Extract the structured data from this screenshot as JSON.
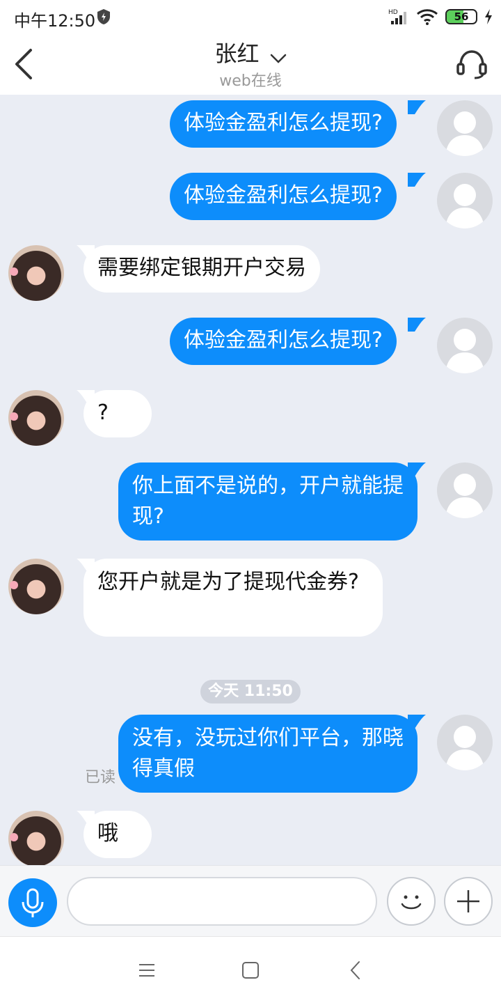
{
  "status_bar": {
    "time": "中午12:50",
    "network_label": "HD",
    "battery_level": "56",
    "battery_fraction": 0.56
  },
  "header": {
    "contact_name": "张红",
    "online_status": "web在线"
  },
  "messages": [
    {
      "sender": "me",
      "text": "体验金盈利怎么提现?"
    },
    {
      "sender": "me",
      "text": "体验金盈利怎么提现?"
    },
    {
      "sender": "them",
      "text": "需要绑定银期开户交易"
    },
    {
      "sender": "me",
      "text": "体验金盈利怎么提现?"
    },
    {
      "sender": "them",
      "text": "?"
    },
    {
      "sender": "me",
      "text": "你上面不是说的，开户就能提现?"
    },
    {
      "sender": "them",
      "text": "您开户就是为了提现代金券?"
    },
    {
      "sender": "me",
      "text": "没有，没玩过你们平台，那晓得真假"
    },
    {
      "sender": "them",
      "text": "哦"
    }
  ],
  "timestamp_divider": "今天 11:50",
  "read_receipt": "已读",
  "input": {
    "value": "",
    "placeholder": ""
  },
  "colors": {
    "accent": "#0d8dfb",
    "chat_background": "#eaedf4",
    "bubble_them": "#ffffff"
  },
  "icons": {
    "mic": "microphone-icon",
    "emoji": "smiley-icon",
    "plus": "plus-icon",
    "back": "chevron-left-icon",
    "contact": "headset-icon"
  }
}
